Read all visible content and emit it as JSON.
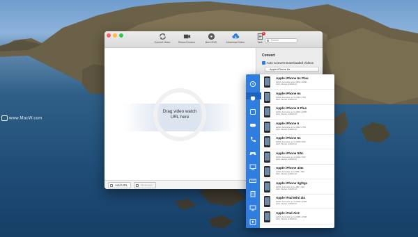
{
  "desktop": {
    "watermark": "www.MacW.com"
  },
  "window": {
    "traffic_lights": [
      "#fc605c",
      "#fdbc40",
      "#34c84a"
    ],
    "toolbar": [
      {
        "label": "Convert Video",
        "icon": "convert-icon"
      },
      {
        "label": "Record Screen",
        "icon": "camera-icon"
      },
      {
        "label": "Burn DVD",
        "icon": "disc-icon"
      },
      {
        "label": "Download Video",
        "icon": "cloud-download-icon"
      },
      {
        "label": "Task",
        "icon": "task-icon",
        "badge": "1"
      }
    ],
    "search_placeholder": "Search"
  },
  "main": {
    "drop_text": "Drag video watch URL here",
    "add_url_label": "Add URL",
    "remove_label": "Remove"
  },
  "convert_panel": {
    "title": "Convert",
    "auto_convert_label": "Auto Convert Downloaded Videos",
    "auto_convert_checked": true,
    "selected_device": "Apple iPhone 6s"
  },
  "device_popover": {
    "categories": [
      "clock-icon",
      "apple-icon",
      "tablet-icon",
      "game-icon",
      "phone-icon",
      "gamepad-icon",
      "tv-icon",
      "keyboard-icon",
      "film-icon",
      "monitor-icon",
      "play-icon"
    ],
    "active_category": 1,
    "devices": [
      {
        "name": "Apple iPhone 6s Plus",
        "spec1": "H264, Auto size up to 1920 x 1080",
        "spec2": "AAC, Stereo, 44100 Hz"
      },
      {
        "name": "Apple iPhone 6s",
        "spec1": "H264, Auto size up to 1334 x 750",
        "spec2": "AAC, Stereo, 44100 Hz"
      },
      {
        "name": "Apple iPhone 6 Plus",
        "spec1": "H264, Auto size up to 1920 x 1080",
        "spec2": "AAC, Stereo, 44100 Hz"
      },
      {
        "name": "Apple iPhone 6",
        "spec1": "H264, Auto size up to 1334 x 750",
        "spec2": "AAC, Stereo, 44100 Hz"
      },
      {
        "name": "Apple iPhone 5s",
        "spec1": "H264, Auto size up to 1136 x 640",
        "spec2": "AAC, Stereo, 44100 Hz"
      },
      {
        "name": "Apple iPhone 5/5c",
        "spec1": "H264, Auto size up to 1136 x 640",
        "spec2": "AAC, Stereo, 44100 Hz"
      },
      {
        "name": "Apple iPhone 4/4s",
        "spec1": "H264, Auto size up to 960 x 640",
        "spec2": "AAC, Stereo, 44100 Hz"
      },
      {
        "name": "Apple iPhone 3g/3gs",
        "spec1": "H264, Auto size up to 480 x 320",
        "spec2": "AAC, Stereo, 44100 Hz"
      },
      {
        "name": "Apple iPad Mini 3/4",
        "spec1": "H264, Auto size up to 2048 x 1536",
        "spec2": "AAC, Stereo, 44100 Hz"
      },
      {
        "name": "Apple iPad Air2",
        "spec1": "H264, Auto size up to 2048 x 1536",
        "spec2": "AAC, Stereo, 44100 Hz"
      }
    ]
  }
}
